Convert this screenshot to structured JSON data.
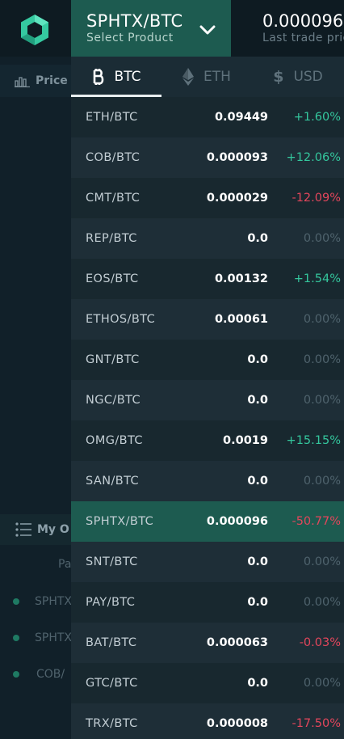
{
  "header": {
    "product_name": "SPHTX/BTC",
    "product_sub": "Select Product",
    "last_price": "0.000096",
    "last_label": "Last trade price"
  },
  "background": {
    "price_label": "Price",
    "orders_label": "My O",
    "pair_header": "Pa",
    "orders": [
      "SPHTX",
      "SPHTX",
      "COB/"
    ]
  },
  "tabs": [
    {
      "label": "BTC",
      "icon": "bitcoin-icon",
      "active": true
    },
    {
      "label": "ETH",
      "icon": "ethereum-icon",
      "active": false
    },
    {
      "label": "USD",
      "icon": "dollar-icon",
      "active": false
    }
  ],
  "markets": [
    {
      "pair": "ETH/BTC",
      "price": "0.09449",
      "change": "+1.60%",
      "dir": "up"
    },
    {
      "pair": "COB/BTC",
      "price": "0.000093",
      "change": "+12.06%",
      "dir": "up"
    },
    {
      "pair": "CMT/BTC",
      "price": "0.000029",
      "change": "-12.09%",
      "dir": "down"
    },
    {
      "pair": "REP/BTC",
      "price": "0.0",
      "change": "0.00%",
      "dir": "zero"
    },
    {
      "pair": "EOS/BTC",
      "price": "0.00132",
      "change": "+1.54%",
      "dir": "up"
    },
    {
      "pair": "ETHOS/BTC",
      "price": "0.00061",
      "change": "0.00%",
      "dir": "zero"
    },
    {
      "pair": "GNT/BTC",
      "price": "0.0",
      "change": "0.00%",
      "dir": "zero"
    },
    {
      "pair": "NGC/BTC",
      "price": "0.0",
      "change": "0.00%",
      "dir": "zero"
    },
    {
      "pair": "OMG/BTC",
      "price": "0.0019",
      "change": "+15.15%",
      "dir": "up"
    },
    {
      "pair": "SAN/BTC",
      "price": "0.0",
      "change": "0.00%",
      "dir": "zero"
    },
    {
      "pair": "SPHTX/BTC",
      "price": "0.000096",
      "change": "-50.77%",
      "dir": "down",
      "selected": true
    },
    {
      "pair": "SNT/BTC",
      "price": "0.0",
      "change": "0.00%",
      "dir": "zero"
    },
    {
      "pair": "PAY/BTC",
      "price": "0.0",
      "change": "0.00%",
      "dir": "zero"
    },
    {
      "pair": "BAT/BTC",
      "price": "0.000063",
      "change": "-0.03%",
      "dir": "down"
    },
    {
      "pair": "GTC/BTC",
      "price": "0.0",
      "change": "0.00%",
      "dir": "zero"
    },
    {
      "pair": "TRX/BTC",
      "price": "0.000008",
      "change": "-17.50%",
      "dir": "down"
    }
  ],
  "colors": {
    "accent": "#1d5b50",
    "up": "#34c79d",
    "down": "#e4465c",
    "neutral": "#4f636d"
  }
}
